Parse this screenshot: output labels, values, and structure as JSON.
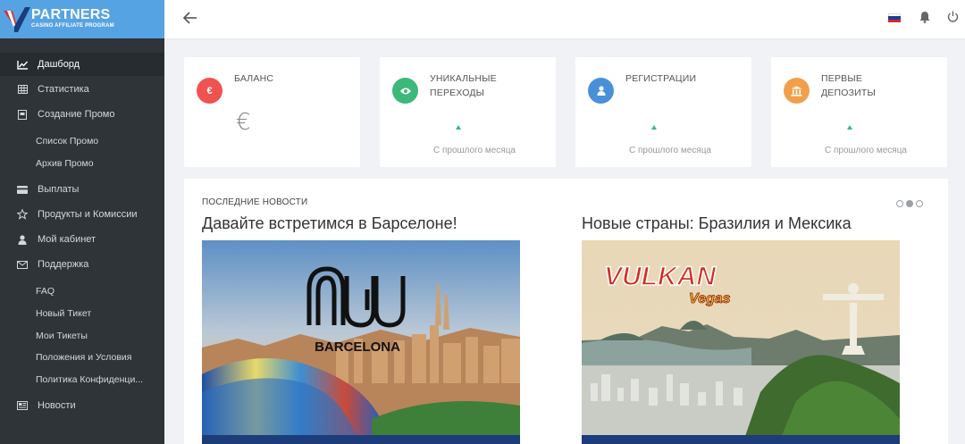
{
  "brand": {
    "title": "PARTNERS",
    "subtitle": "CASINO AFFILIATE PROGRAM",
    "colors": {
      "primary": "#56a3e3",
      "red": "#d0343a",
      "navy": "#1c3c7a"
    }
  },
  "sidebar": {
    "items": [
      {
        "label": "Дашборд",
        "icon": "chart-line-icon",
        "active": true
      },
      {
        "label": "Статистика",
        "icon": "table-icon"
      },
      {
        "label": "Создание Промо",
        "icon": "file-icon"
      },
      {
        "label": "Выплаты",
        "icon": "credit-card-icon"
      },
      {
        "label": "Продукты и Комиссии",
        "icon": "star-icon"
      },
      {
        "label": "Мой кабинет",
        "icon": "user-icon"
      },
      {
        "label": "Поддержка",
        "icon": "envelope-icon"
      },
      {
        "label": "Новости",
        "icon": "newspaper-icon"
      }
    ],
    "promo_sub": [
      "Список Промо",
      "Архив Промо"
    ],
    "support_sub": [
      "FAQ",
      "Новый Тикет",
      "Мои Тикеты",
      "Положения и Условия",
      "Политика Конфиденци..."
    ]
  },
  "topbar": {
    "back_icon": "arrow-left-icon",
    "flag_icon": "russia-flag-icon",
    "bell_icon": "bell-icon",
    "power_icon": "power-icon"
  },
  "stats": [
    {
      "label": "БАЛАНС",
      "value": "€",
      "color": "#ef5350",
      "icon": "euro-icon"
    },
    {
      "label": "УНИКАЛЬНЫЕ\nПЕРЕХОДЫ",
      "since": "С прошлого месяца",
      "color": "#3cb878",
      "icon": "eye-icon"
    },
    {
      "label": "РЕГИСТРАЦИИ",
      "since": "С прошлого месяца",
      "color": "#4a90d9",
      "icon": "user-icon"
    },
    {
      "label": "ПЕРВЫЕ\nДЕПОЗИТЫ",
      "since": "С прошлого месяца",
      "color": "#f0a04b",
      "icon": "bank-icon"
    }
  ],
  "news": {
    "heading": "ПОСЛЕДНИЕ НОВОСТИ",
    "items": [
      {
        "title": "Давайте встретимся в Барселоне!",
        "image_text": "BARCELONA",
        "logo_text": "AW"
      },
      {
        "title": "Новые страны: Бразилия и Мексика",
        "image_text": "VULKAN",
        "image_subtext": "Vegas"
      }
    ],
    "dots": 3,
    "active_dot": 1
  }
}
